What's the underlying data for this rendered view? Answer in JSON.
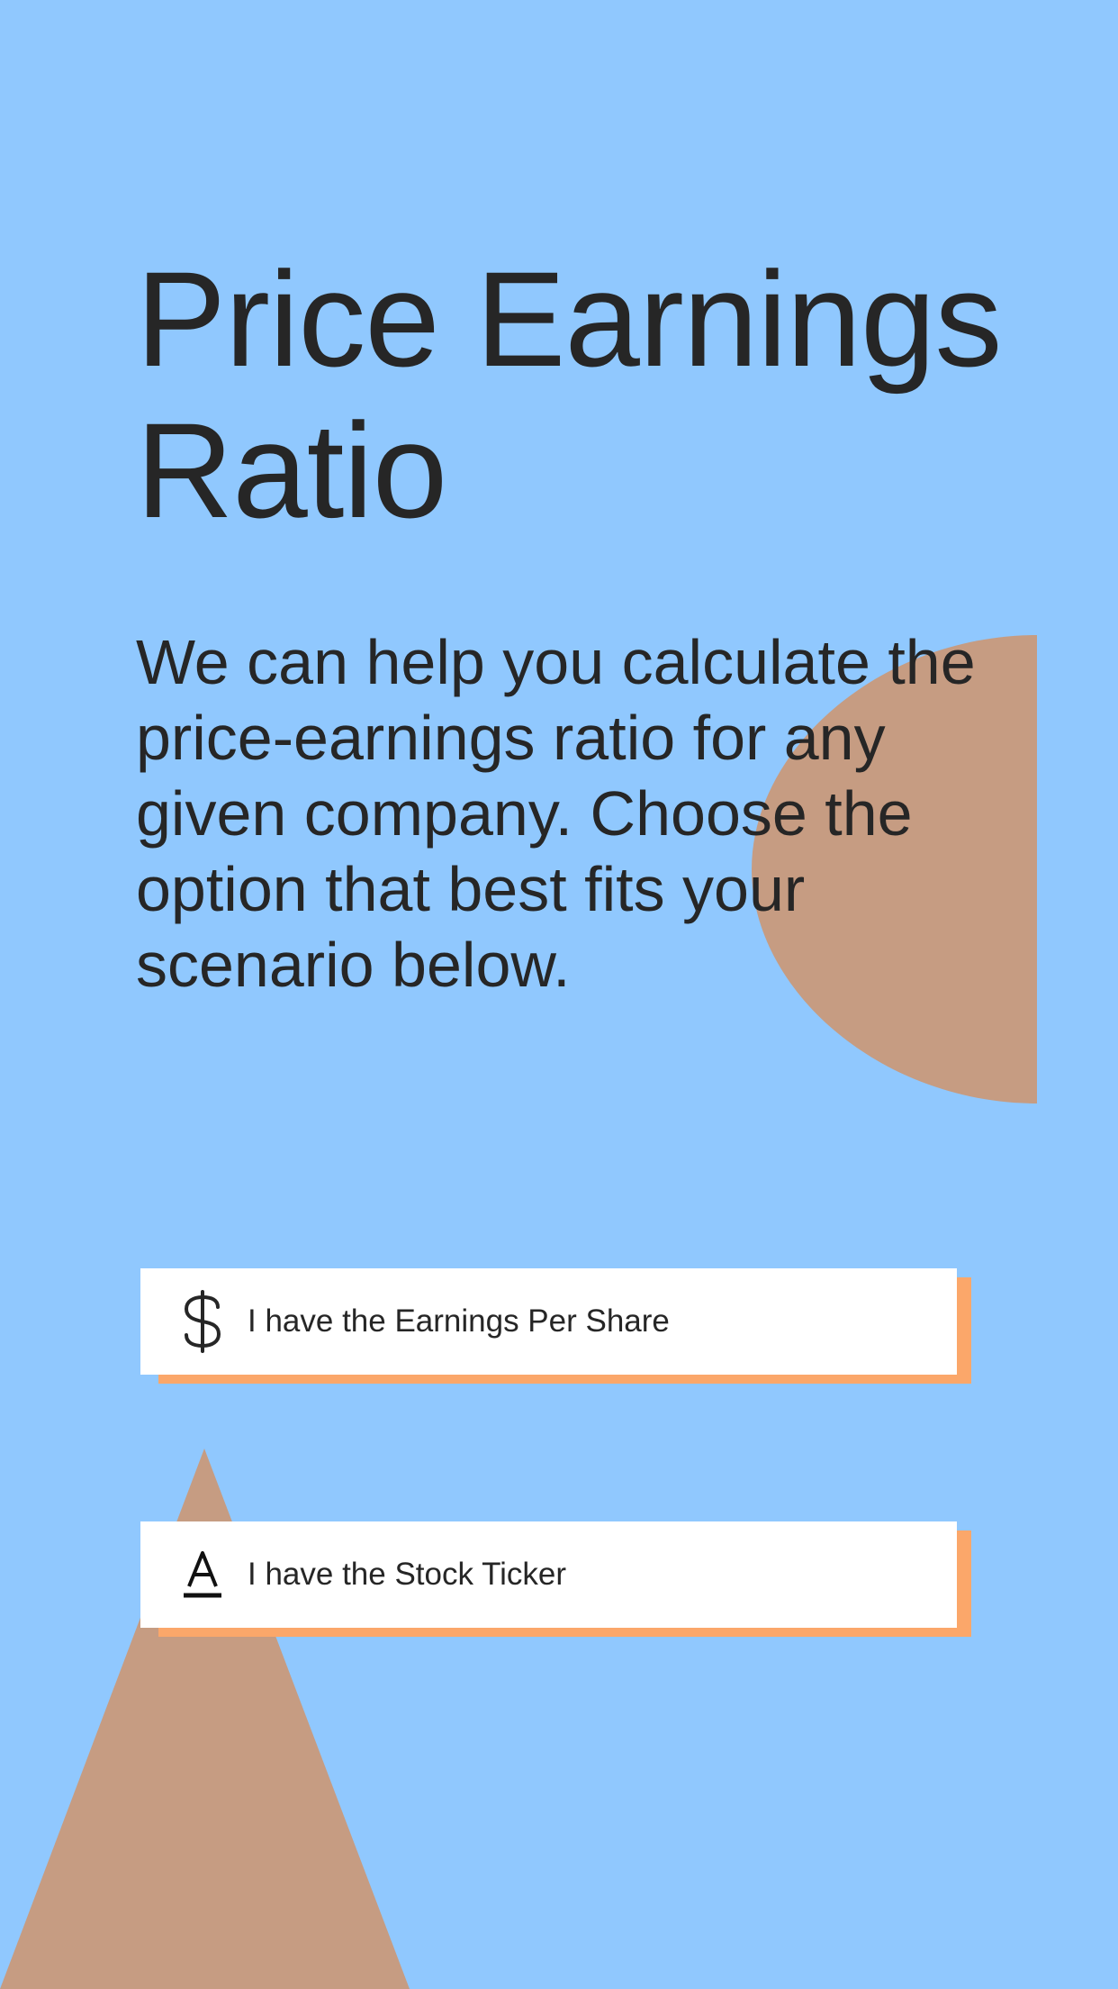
{
  "colors": {
    "background": "#90c8fe",
    "shape": "#c69c82",
    "card_shadow": "#fba76a",
    "text": "#262626",
    "card": "#ffffff"
  },
  "header": {
    "title_line1": "Price Earnings",
    "title_line2": "Ratio"
  },
  "intro": {
    "text": "We can help you calculate the price-earnings ratio for any given company. Choose the option that best fits your scenario below."
  },
  "options": [
    {
      "label": "I have the Earnings Per Share",
      "icon": "dollar-icon"
    },
    {
      "label": "I have the Stock Ticker",
      "icon": "text-a-icon"
    }
  ]
}
